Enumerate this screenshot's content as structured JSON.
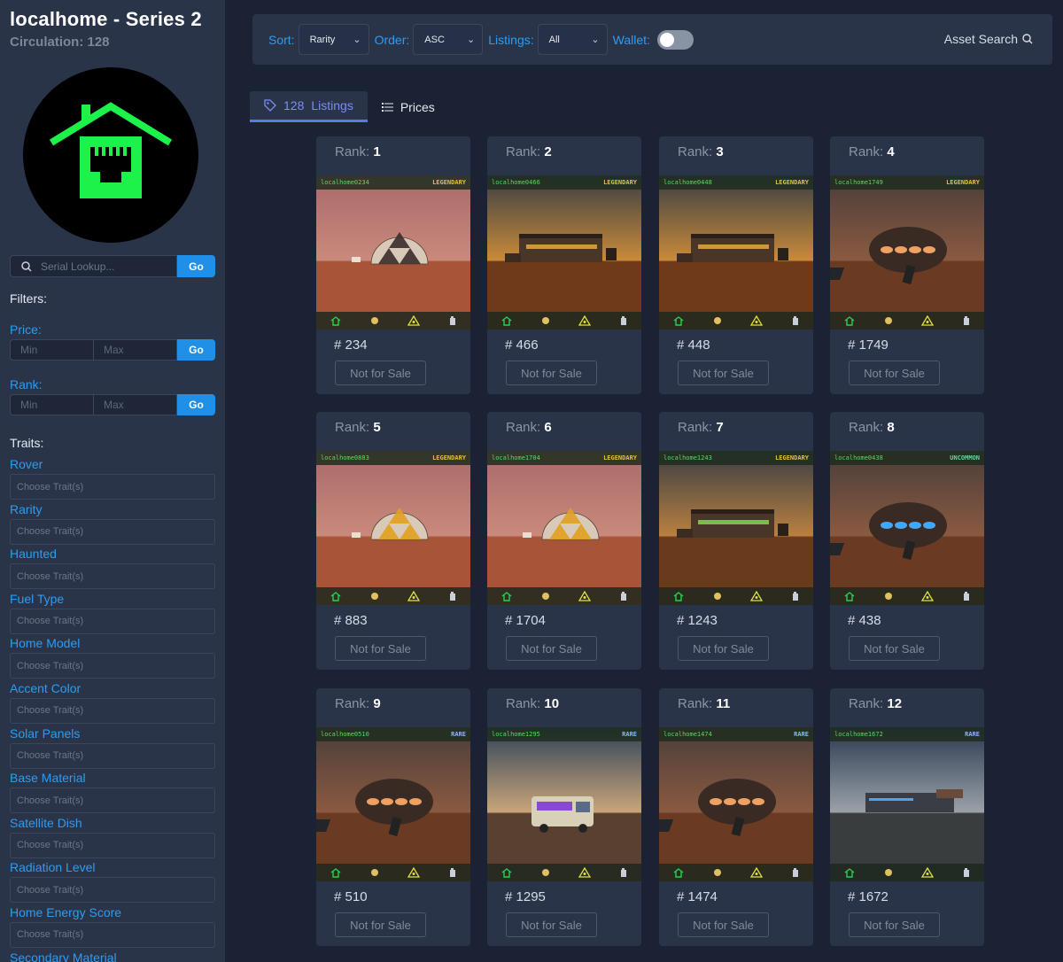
{
  "sidebar": {
    "title": "localhome - Series 2",
    "circulation": "Circulation: 128",
    "serial_placeholder": "Serial Lookup...",
    "go_label": "Go",
    "filters_label": "Filters:",
    "price_label": "Price:",
    "rank_label": "Rank:",
    "min_placeholder": "Min",
    "max_placeholder": "Max",
    "traits_label": "Traits:",
    "trait_placeholder": "Choose Trait(s)",
    "traits": [
      "Rover",
      "Rarity",
      "Haunted",
      "Fuel Type",
      "Home Model",
      "Accent Color",
      "Solar Panels",
      "Base Material",
      "Satellite Dish",
      "Radiation Level",
      "Home Energy Score",
      "Secondary Material"
    ]
  },
  "topbar": {
    "sort_label": "Sort:",
    "sort_value": "Rarity",
    "order_label": "Order:",
    "order_value": "ASC",
    "listings_label": "Listings:",
    "listings_value": "All",
    "wallet_label": "Wallet:",
    "wallet_on": false,
    "asset_search_label": "Asset Search"
  },
  "tabs": {
    "listings_count": "128",
    "listings_label": "Listings",
    "prices_label": "Prices"
  },
  "colors": {
    "accent": "#2d9cf0",
    "go_button": "#1f8fe8",
    "logo_green": "#1cf24a",
    "tab_active": "#7a8cf5"
  },
  "rank_prefix": "Rank:",
  "cards": [
    {
      "rank": "1",
      "serial": "# 234",
      "tag": "localhome0234",
      "rarity": "LEGENDARY",
      "scene": "dome-dusk",
      "status": "Not for Sale"
    },
    {
      "rank": "2",
      "serial": "# 466",
      "tag": "localhome0466",
      "rarity": "LEGENDARY",
      "scene": "bunker-sunset",
      "status": "Not for Sale"
    },
    {
      "rank": "3",
      "serial": "# 448",
      "tag": "localhome0448",
      "rarity": "LEGENDARY",
      "scene": "bunker-sunset",
      "status": "Not for Sale"
    },
    {
      "rank": "4",
      "serial": "# 1749",
      "tag": "localhome1749",
      "rarity": "LEGENDARY",
      "scene": "ufo-pod",
      "status": "Not for Sale"
    },
    {
      "rank": "5",
      "serial": "# 883",
      "tag": "localhome0883",
      "rarity": "LEGENDARY",
      "scene": "dome-gold",
      "status": "Not for Sale"
    },
    {
      "rank": "6",
      "serial": "# 1704",
      "tag": "localhome1704",
      "rarity": "LEGENDARY",
      "scene": "dome-gold",
      "status": "Not for Sale"
    },
    {
      "rank": "7",
      "serial": "# 1243",
      "tag": "localhome1243",
      "rarity": "LEGENDARY",
      "scene": "bunker-green",
      "status": "Not for Sale"
    },
    {
      "rank": "8",
      "serial": "# 438",
      "tag": "localhome0438",
      "rarity": "UNCOMMON",
      "scene": "ufo-blue",
      "status": "Not for Sale"
    },
    {
      "rank": "9",
      "serial": "# 510",
      "tag": "localhome0510",
      "rarity": "RARE",
      "scene": "ufo-pod",
      "status": "Not for Sale"
    },
    {
      "rank": "10",
      "serial": "# 1295",
      "tag": "localhome1295",
      "rarity": "RARE",
      "scene": "rv-camper",
      "status": "Not for Sale"
    },
    {
      "rank": "11",
      "serial": "# 1474",
      "tag": "localhome1474",
      "rarity": "RARE",
      "scene": "ufo-pod",
      "status": "Not for Sale"
    },
    {
      "rank": "12",
      "serial": "# 1672",
      "tag": "localhome1672",
      "rarity": "RARE",
      "scene": "module-night",
      "status": "Not for Sale"
    }
  ]
}
